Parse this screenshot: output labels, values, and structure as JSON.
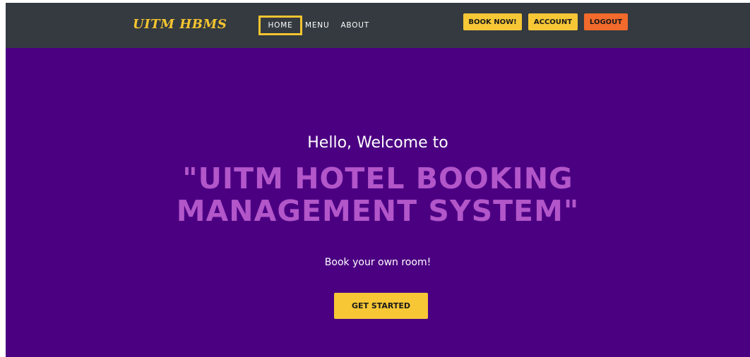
{
  "navbar": {
    "brand": "UITM HBMS",
    "links": [
      {
        "label": "HOME"
      },
      {
        "label": "MENU"
      },
      {
        "label": "ABOUT"
      }
    ],
    "buttons": {
      "book_now": "BOOK NOW!",
      "account": "ACCOUNT",
      "logout": "LOGOUT"
    }
  },
  "hero": {
    "greeting": "Hello, Welcome to",
    "title_line1": "\"UITM HOTEL BOOKING",
    "title_line2": "MANAGEMENT SYSTEM\"",
    "tagline": "Book your own room!",
    "cta_label": "GET STARTED"
  },
  "colors": {
    "navbar_bg": "#343a40",
    "hero_bg": "#4b0082",
    "accent_yellow": "#f7c736",
    "logout_orange": "#f26a2c",
    "title_purple": "#b256c9"
  }
}
